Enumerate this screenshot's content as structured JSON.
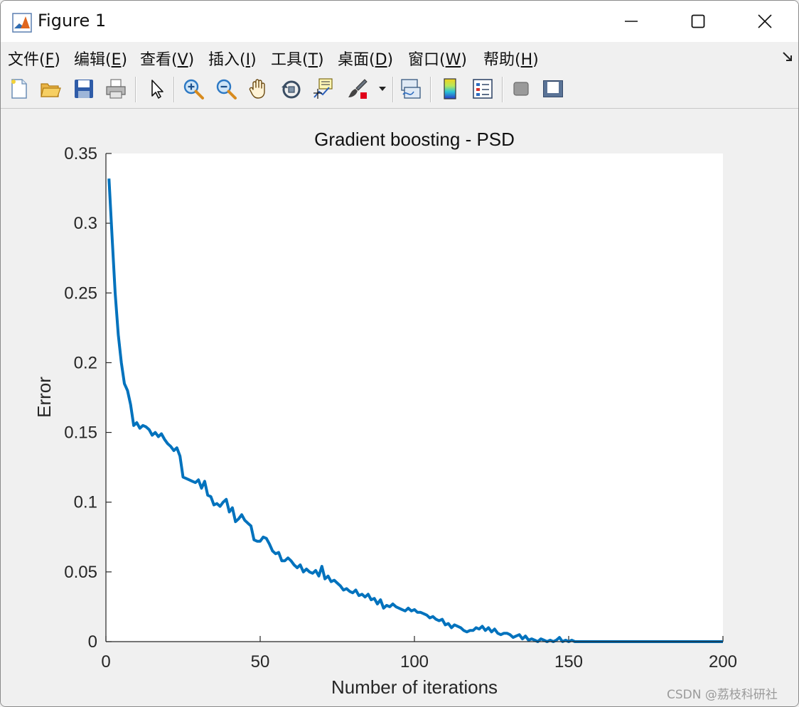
{
  "window": {
    "title": "Figure 1",
    "controls": [
      "minimize",
      "maximize",
      "close"
    ]
  },
  "menu": {
    "items": [
      {
        "label": "文件(",
        "key": "F",
        "tail": ")"
      },
      {
        "label": "编辑(",
        "key": "E",
        "tail": ")"
      },
      {
        "label": "查看(",
        "key": "V",
        "tail": ")"
      },
      {
        "label": "插入(",
        "key": "I",
        "tail": ")"
      },
      {
        "label": "工具(",
        "key": "T",
        "tail": ")"
      },
      {
        "label": "桌面(",
        "key": "D",
        "tail": ")"
      },
      {
        "label": "窗口(",
        "key": "W",
        "tail": ")"
      },
      {
        "label": "帮助(",
        "key": "H",
        "tail": ")"
      }
    ]
  },
  "toolbar": {
    "icons": [
      "new-figure-icon",
      "open-file-icon",
      "save-icon",
      "print-icon",
      "edit-plot-arrow-icon",
      "zoom-in-icon",
      "zoom-out-icon",
      "pan-hand-icon",
      "rotate-3d-icon",
      "data-cursor-icon",
      "brush-icon",
      "brush-dropdown-icon",
      "link-plot-icon",
      "colorbar-icon",
      "legend-icon",
      "hide-plot-tools-icon",
      "show-plot-tools-icon"
    ]
  },
  "chart_data": {
    "type": "line",
    "title": "Gradient boosting - PSD",
    "xlabel": "Number of iterations",
    "ylabel": "Error",
    "xlim": [
      0,
      200
    ],
    "ylim": [
      0,
      0.35
    ],
    "xticks": [
      "0",
      "50",
      "100",
      "150",
      "200"
    ],
    "yticks": [
      "0",
      "0.05",
      "0.1",
      "0.15",
      "0.2",
      "0.25",
      "0.3",
      "0.35"
    ],
    "grid": false,
    "color": "#0072bd",
    "x": [
      1,
      2,
      3,
      4,
      5,
      6,
      7,
      8,
      9,
      10,
      11,
      12,
      13,
      14,
      15,
      16,
      17,
      18,
      19,
      20,
      21,
      22,
      23,
      24,
      25,
      26,
      27,
      28,
      29,
      30,
      31,
      32,
      33,
      34,
      35,
      36,
      37,
      38,
      39,
      40,
      41,
      42,
      43,
      44,
      45,
      46,
      47,
      48,
      49,
      50,
      51,
      52,
      53,
      54,
      55,
      56,
      57,
      58,
      59,
      60,
      61,
      62,
      63,
      64,
      65,
      66,
      67,
      68,
      69,
      70,
      71,
      72,
      73,
      74,
      75,
      76,
      77,
      78,
      79,
      80,
      81,
      82,
      83,
      84,
      85,
      86,
      87,
      88,
      89,
      90,
      91,
      92,
      93,
      94,
      95,
      96,
      97,
      98,
      99,
      100,
      101,
      102,
      103,
      104,
      105,
      106,
      107,
      108,
      109,
      110,
      111,
      112,
      113,
      114,
      115,
      116,
      117,
      118,
      119,
      120,
      121,
      122,
      123,
      124,
      125,
      126,
      127,
      128,
      129,
      130,
      131,
      132,
      133,
      134,
      135,
      136,
      137,
      138,
      139,
      140,
      141,
      142,
      143,
      144,
      145,
      146,
      147,
      148,
      149,
      150,
      151,
      152,
      153,
      154,
      155,
      156,
      157,
      158,
      159,
      160,
      161,
      162,
      163,
      164,
      165,
      166,
      167,
      168,
      169,
      170,
      171,
      172,
      173,
      174,
      175,
      176,
      177,
      178,
      179,
      180,
      181,
      182,
      183,
      184,
      185,
      186,
      187,
      188,
      189,
      190,
      191,
      192,
      193,
      194,
      195,
      196,
      197,
      198,
      199,
      200
    ],
    "y": [
      0.332,
      0.29,
      0.25,
      0.22,
      0.2,
      0.185,
      0.18,
      0.17,
      0.155,
      0.157,
      0.153,
      0.155,
      0.154,
      0.152,
      0.148,
      0.15,
      0.147,
      0.149,
      0.145,
      0.142,
      0.14,
      0.137,
      0.139,
      0.133,
      0.118,
      0.117,
      0.116,
      0.115,
      0.114,
      0.116,
      0.11,
      0.115,
      0.105,
      0.104,
      0.098,
      0.099,
      0.097,
      0.1,
      0.102,
      0.093,
      0.096,
      0.086,
      0.088,
      0.091,
      0.087,
      0.085,
      0.083,
      0.073,
      0.072,
      0.072,
      0.075,
      0.074,
      0.07,
      0.065,
      0.063,
      0.064,
      0.058,
      0.058,
      0.06,
      0.058,
      0.055,
      0.053,
      0.055,
      0.05,
      0.052,
      0.05,
      0.049,
      0.051,
      0.047,
      0.054,
      0.045,
      0.047,
      0.043,
      0.044,
      0.042,
      0.04,
      0.037,
      0.038,
      0.036,
      0.035,
      0.037,
      0.033,
      0.034,
      0.032,
      0.034,
      0.03,
      0.031,
      0.027,
      0.03,
      0.024,
      0.026,
      0.025,
      0.027,
      0.025,
      0.024,
      0.023,
      0.022,
      0.024,
      0.022,
      0.023,
      0.021,
      0.021,
      0.02,
      0.019,
      0.017,
      0.018,
      0.016,
      0.015,
      0.016,
      0.012,
      0.013,
      0.01,
      0.012,
      0.011,
      0.01,
      0.008,
      0.007,
      0.008,
      0.008,
      0.01,
      0.009,
      0.011,
      0.008,
      0.01,
      0.007,
      0.009,
      0.006,
      0.005,
      0.006,
      0.006,
      0.005,
      0.003,
      0.004,
      0.005,
      0.002,
      0.004,
      0.001,
      0.002,
      0.001,
      0.0,
      0.002,
      0.001,
      0.0,
      0.001,
      0.0,
      0.001,
      0.003,
      0.0,
      0.001,
      0.0,
      0.001,
      0.0,
      0.0,
      0.0,
      0.0,
      0.0,
      0.0,
      0.0,
      0.0,
      0.0,
      0.0,
      0.0,
      0.0,
      0.0,
      0.0,
      0.0,
      0.0,
      0.0,
      0.0,
      0.0,
      0.0,
      0.0,
      0.0,
      0.0,
      0.0,
      0.0,
      0.0,
      0.0,
      0.0,
      0.0,
      0.0,
      0.0,
      0.0,
      0.0,
      0.0,
      0.0,
      0.0,
      0.0,
      0.0,
      0.0,
      0.0,
      0.0,
      0.0,
      0.0,
      0.0,
      0.0,
      0.0,
      0.0,
      0.0,
      0.0,
      0.0,
      0.0
    ]
  },
  "watermark": "CSDN @荔枝科研社"
}
